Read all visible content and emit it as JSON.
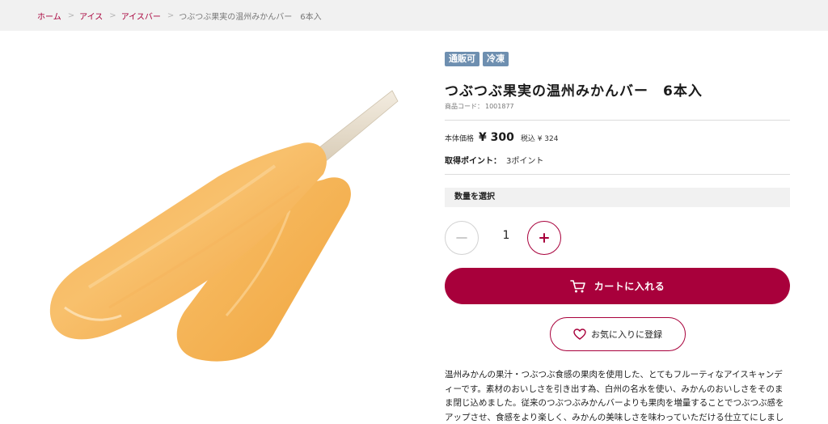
{
  "breadcrumb": {
    "items": [
      "ホーム",
      "アイス",
      "アイスバー"
    ],
    "separator": ">",
    "current": "つぶつぶ果実の温州みかんバー　6本入"
  },
  "product": {
    "image_alt": "つぶつぶ果実の温州みかんバー",
    "tags": [
      "通販可",
      "冷凍"
    ],
    "title": "つぶつぶ果実の温州みかんバー　6本入",
    "code_label": "商品コード：",
    "code": "1001877",
    "price_label": "本体価格",
    "price": "¥ 300",
    "tax_price": "税込 ¥ 324",
    "points_label": "取得ポイント：",
    "points_value": "3ポイント"
  },
  "quantity": {
    "header": "数量を選択",
    "value": "1"
  },
  "actions": {
    "cart_label": "カートに入れる",
    "favorite_label": "お気に入りに登録"
  },
  "description": "温州みかんの果汁・つぶつぶ食感の果肉を使用した、とてもフルーティなアイスキャンディーです。素材のおいしさを引き出す為、白州の名水を使い、みかんのおいしさをそのまま閉じ込めました。従来のつぶつぶみかんバーよりも果肉を増量することでつぶつぶ感をアップさせ、食感をより楽しく、みかんの美味しさを味わっていただける仕立てにしました。",
  "colors": {
    "accent": "#a8003b",
    "tag": "#6e8fb0",
    "breadcrumb_bg": "#f1f1f1"
  },
  "icons": {
    "cart": "cart-icon",
    "heart": "heart-icon",
    "minus": "minus-icon",
    "plus": "plus-icon"
  }
}
